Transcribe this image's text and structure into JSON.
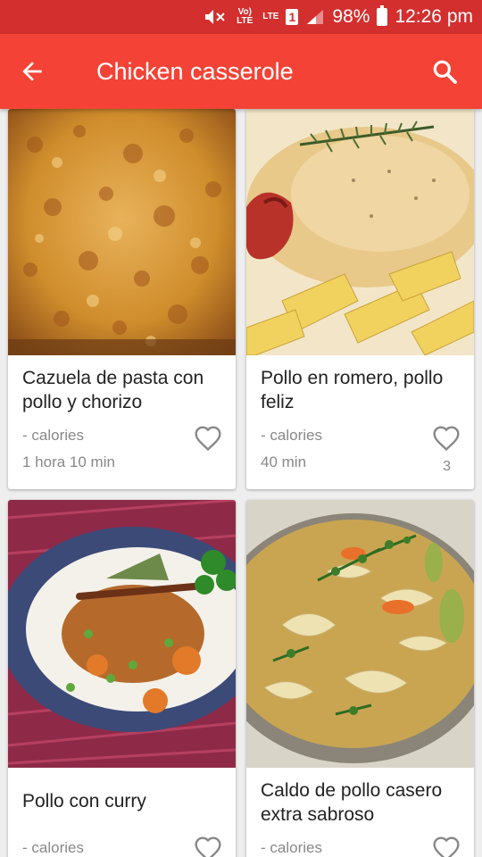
{
  "status_bar": {
    "volte_label": "Vo) LTE",
    "lte_label": "LTE",
    "sim_label": "1",
    "battery": "98%",
    "time": "12:26 pm"
  },
  "app_bar": {
    "title": "Chicken casserole"
  },
  "recipes": [
    {
      "name": "Cazuela de pasta con pollo y chorizo",
      "calories": "- calories",
      "time": "1 hora 10 min",
      "likes": ""
    },
    {
      "name": "Pollo en romero, pollo feliz",
      "calories": "- calories",
      "time": "40 min",
      "likes": "3"
    },
    {
      "name": "Pollo con curry",
      "calories": "- calories",
      "time": "",
      "likes": ""
    },
    {
      "name": "Caldo de pollo casero extra sabroso",
      "calories": "- calories",
      "time": "",
      "likes": ""
    }
  ],
  "colors": {
    "status_bar": "#d32f2f",
    "app_bar": "#f44336",
    "background": "#eeeeee"
  }
}
